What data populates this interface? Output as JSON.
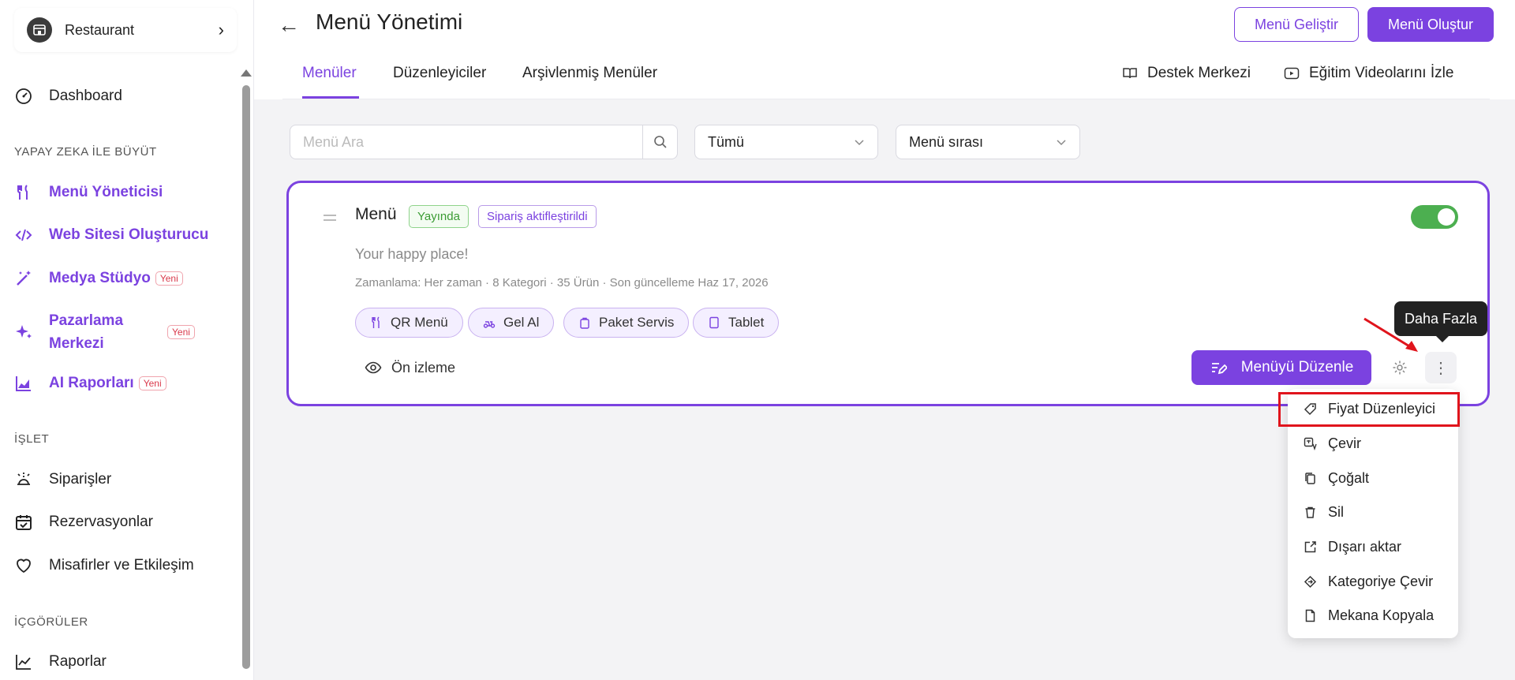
{
  "sidebar": {
    "venue": "Restaurant",
    "dashboard": "Dashboard",
    "section_ai": "YAPAY ZEKA İLE BÜYÜT",
    "menu_manager": "Menü Yöneticisi",
    "website_builder": "Web Sitesi Oluşturucu",
    "media_studio": "Medya Stüdyo",
    "marketing_line1": "Pazarlama",
    "marketing_line2": "Merkezi",
    "ai_reports": "AI Raporları",
    "new_badge": "Yeni",
    "section_operate": "İŞLET",
    "orders": "Siparişler",
    "reservations": "Rezervasyonlar",
    "guests": "Misafirler ve Etkileşim",
    "section_insights": "İÇGÖRÜLER",
    "reports": "Raporlar"
  },
  "header": {
    "title": "Menü Yönetimi",
    "improve_button": "Menü Geliştir",
    "create_button": "Menü Oluştur",
    "tabs": [
      "Menüler",
      "Düzenleyiciler",
      "Arşivlenmiş Menüler"
    ],
    "support": "Destek Merkezi",
    "videos": "Eğitim Videolarını İzle"
  },
  "filters": {
    "search_placeholder": "Menü Ara",
    "status_value": "Tümü",
    "sort_value": "Menü sırası"
  },
  "card": {
    "title": "Menü",
    "status": "Yayında",
    "order_status": "Sipariş aktifleştirildi",
    "description": "Your happy place!",
    "meta": "Zamanlama: Her zaman · 8 Kategori · 35 Ürün · Son güncelleme Haz 17, 2026",
    "channels": [
      "QR Menü",
      "Gel Al",
      "Paket Servis",
      "Tablet"
    ],
    "preview": "Ön izleme",
    "edit_button": "Menüyü Düzenle",
    "enabled": true
  },
  "tooltip": "Daha Fazla",
  "dropdown": [
    "Fiyat Düzenleyici",
    "Çevir",
    "Çoğalt",
    "Sil",
    "Dışarı aktar",
    "Kategoriye Çevir",
    "Mekana Kopyala"
  ],
  "colors": {
    "accent": "#7b42e0",
    "green": "#4caf50",
    "annotation": "#e0141c"
  }
}
